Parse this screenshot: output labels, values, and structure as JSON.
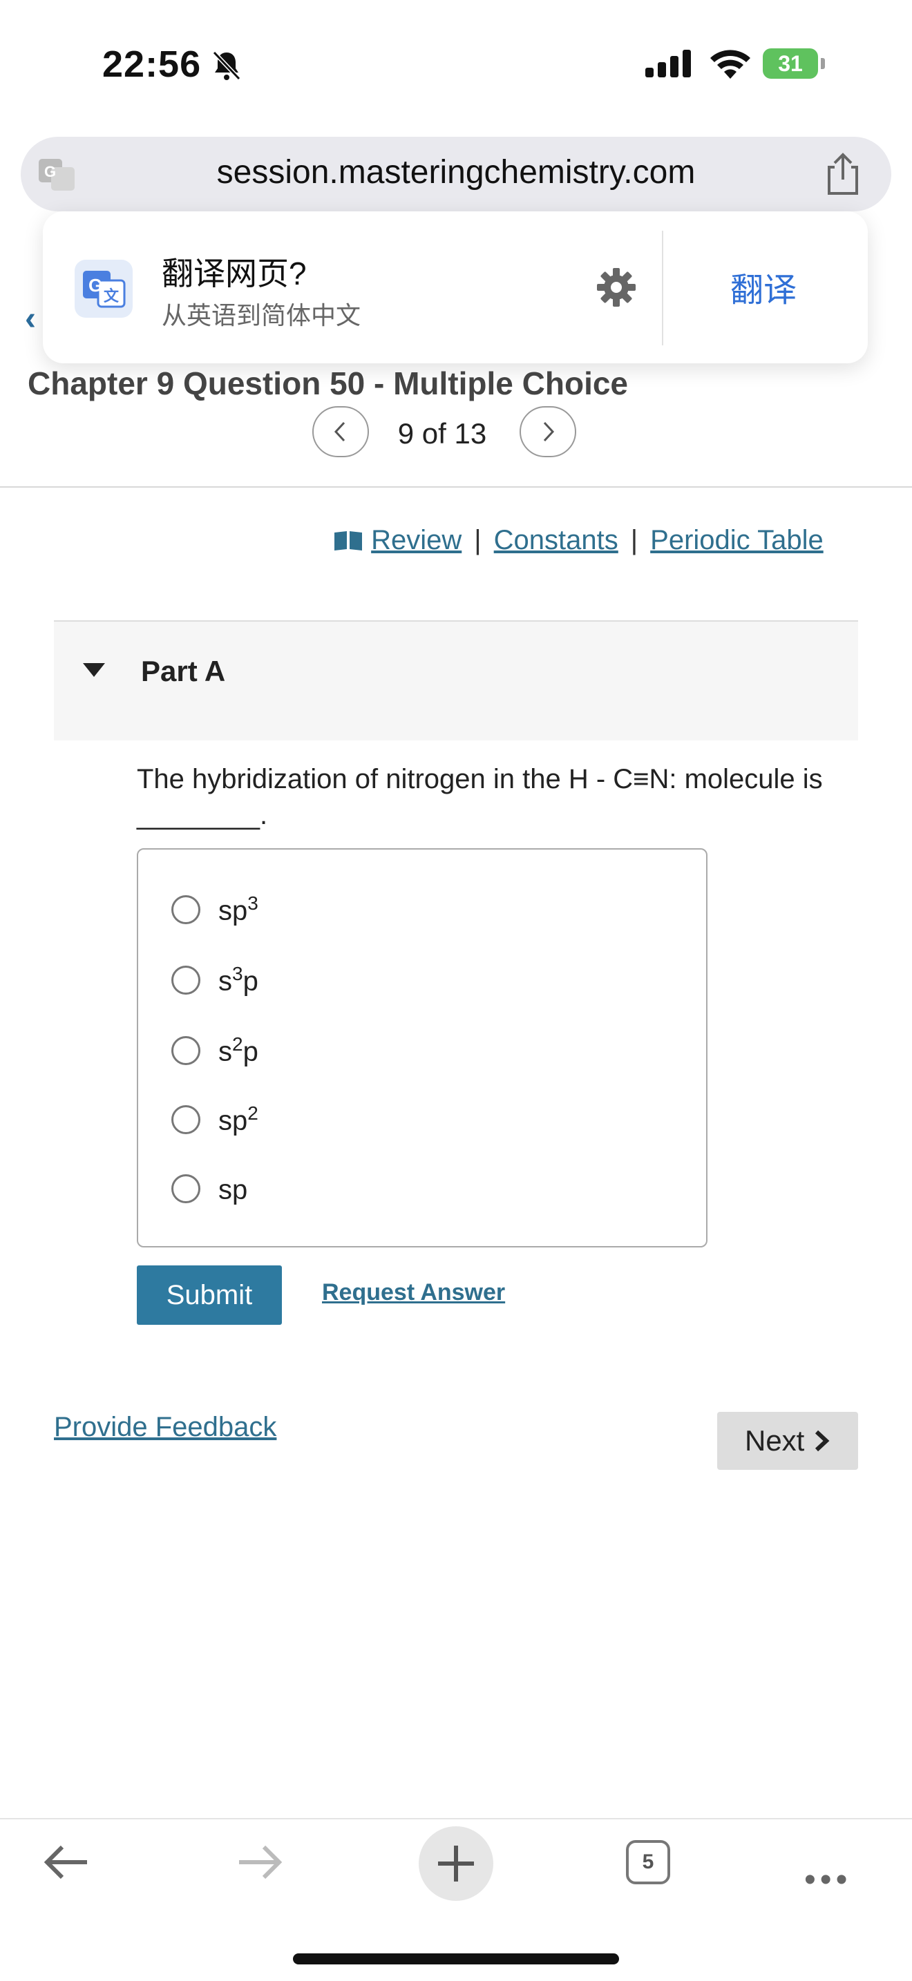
{
  "status_bar": {
    "time": "22:56",
    "battery": "31"
  },
  "browser": {
    "url": "session.masteringchemistry.com"
  },
  "translate_popup": {
    "title": "翻译网页?",
    "subtitle": "从英语到简体中文",
    "action": "翻译"
  },
  "header": {
    "title": "Chapter 9 Question 50 - Multiple Choice",
    "position": "9 of 13"
  },
  "links": {
    "review": "Review",
    "constants": "Constants",
    "periodic_table": "Periodic Table",
    "separator": "|"
  },
  "part": {
    "label": "Part A"
  },
  "question": {
    "text": "The hybridization of nitrogen in the H - C≡N: molecule is",
    "blank": "________."
  },
  "choices": [
    {
      "base": "sp",
      "sup": "3",
      "tail": ""
    },
    {
      "base": "s",
      "sup": "3",
      "tail": "p"
    },
    {
      "base": "s",
      "sup": "2",
      "tail": "p"
    },
    {
      "base": "sp",
      "sup": "2",
      "tail": ""
    },
    {
      "base": "sp",
      "sup": "",
      "tail": ""
    }
  ],
  "actions": {
    "submit": "Submit",
    "request_answer": "Request Answer",
    "provide_feedback": "Provide Feedback",
    "next": "Next"
  },
  "toolbar": {
    "tab_count": "5",
    "more": "•••"
  },
  "colors": {
    "link": "#2f6f8e",
    "submit_bg": "#2e7aa0",
    "translate_blue": "#2f6fd6",
    "battery_green": "#5fc25e"
  }
}
